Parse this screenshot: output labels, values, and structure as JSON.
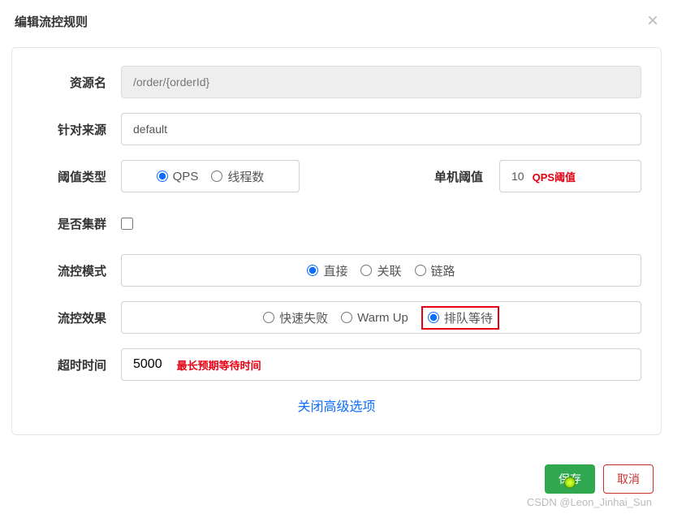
{
  "header": {
    "title": "编辑流控规则",
    "close": "×"
  },
  "labels": {
    "resource": "资源名",
    "source": "针对来源",
    "thresholdType": "阈值类型",
    "singleThreshold": "单机阈值",
    "cluster": "是否集群",
    "mode": "流控模式",
    "effect": "流控效果",
    "timeout": "超时时间"
  },
  "resource": {
    "value": "/order/{orderId}"
  },
  "source": {
    "value": "default"
  },
  "thresholdType": {
    "options": [
      {
        "label": "QPS",
        "checked": true
      },
      {
        "label": "线程数",
        "checked": false
      }
    ]
  },
  "threshold": {
    "value": "10",
    "annotation": "QPS阈值"
  },
  "mode": {
    "options": [
      {
        "label": "直接",
        "checked": true
      },
      {
        "label": "关联",
        "checked": false
      },
      {
        "label": "链路",
        "checked": false
      }
    ]
  },
  "effect": {
    "options": [
      {
        "label": "快速失败",
        "checked": false
      },
      {
        "label": "Warm Up",
        "checked": false
      },
      {
        "label": "排队等待",
        "checked": true
      }
    ]
  },
  "timeout": {
    "value": "5000",
    "annotation": "最长预期等待时间"
  },
  "advanced": {
    "label": "关闭高级选项"
  },
  "actions": {
    "save": "保存",
    "cancel": "取消"
  },
  "watermark": "CSDN @Leon_Jinhai_Sun"
}
